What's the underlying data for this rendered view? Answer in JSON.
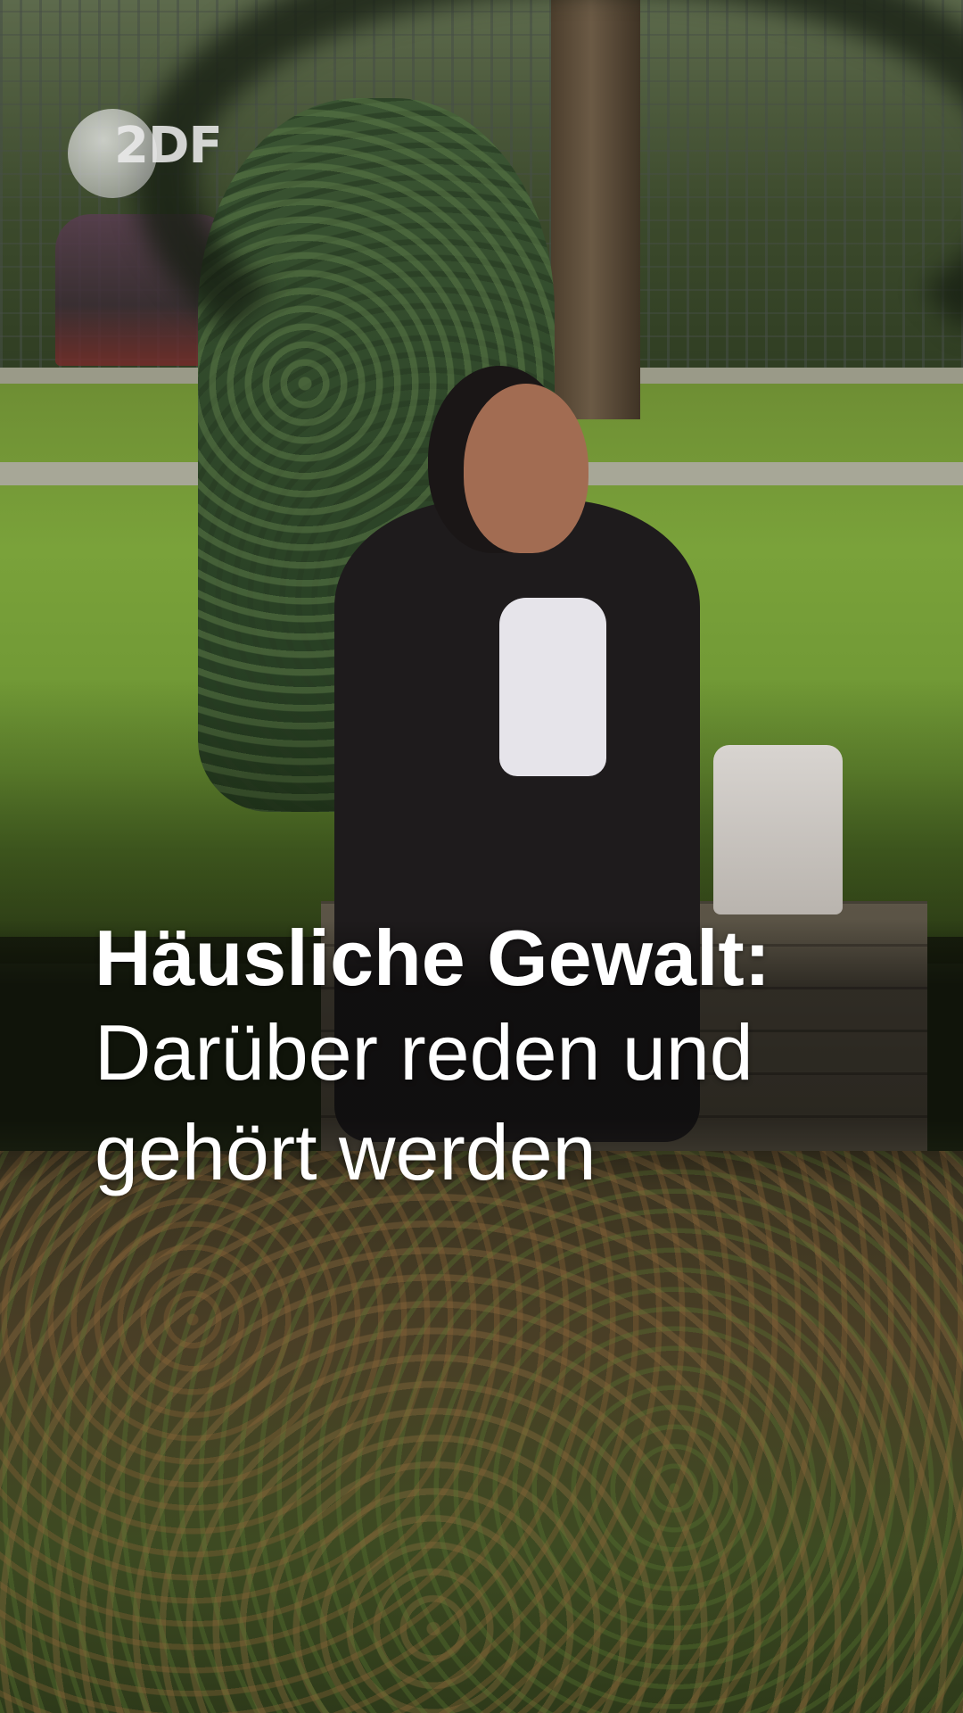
{
  "brand": {
    "logo_text": "2DF",
    "logo_icon": "zdf-logo-icon"
  },
  "caption": {
    "headline": "Häusliche Gewalt:",
    "subline": "Darüber reden und gehört werden"
  },
  "colors": {
    "caption_text": "#ffffff",
    "lawn": "#7aa23a"
  }
}
